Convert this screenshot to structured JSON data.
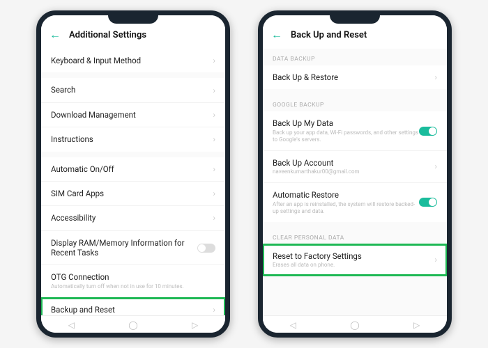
{
  "left": {
    "header_title": "Additional Settings",
    "rows": {
      "keyboard": "Keyboard & Input Method",
      "search": "Search",
      "download": "Download Management",
      "instructions": "Instructions",
      "auto_onoff": "Automatic On/Off",
      "sim": "SIM Card Apps",
      "accessibility": "Accessibility",
      "ram": "Display RAM/Memory Information for Recent Tasks",
      "otg_title": "OTG Connection",
      "otg_sub": "Automatically turn off when not in use for 10 minutes.",
      "backup_reset": "Backup and Reset"
    }
  },
  "right": {
    "header_title": "Back Up and Reset",
    "sections": {
      "data_backup": "DATA BACKUP",
      "google_backup": "GOOGLE BACKUP",
      "clear": "CLEAR PERSONAL DATA"
    },
    "rows": {
      "backup_restore": "Back Up & Restore",
      "backup_my_data": "Back Up My Data",
      "backup_my_data_sub": "Back up your app data, Wi-Fi passwords, and other settings to Google's servers.",
      "backup_account": "Back Up Account",
      "backup_account_sub": "naveenkumarthakur00@gmail.com",
      "auto_restore": "Automatic Restore",
      "auto_restore_sub": "After an app is reinstalled, the system will restore backed-up settings and data.",
      "factory_reset": "Reset to Factory Settings",
      "factory_reset_sub": "Erases all data on phone."
    }
  }
}
